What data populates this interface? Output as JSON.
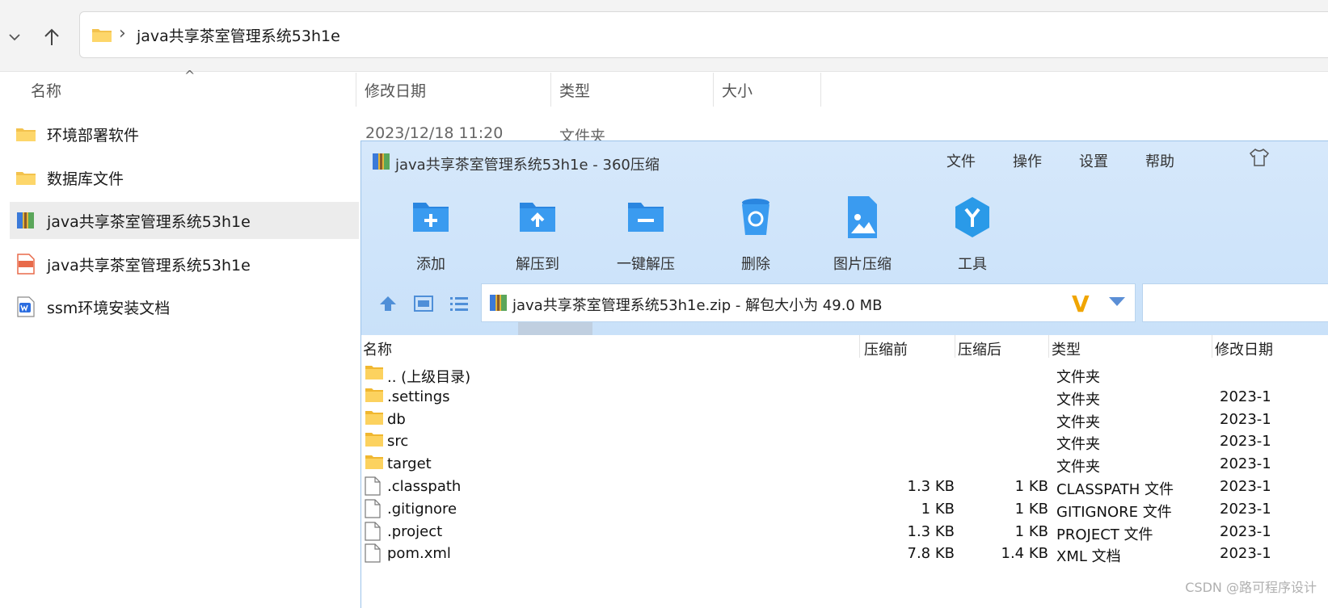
{
  "explorer": {
    "address_path": "java共享茶室管理系统53h1e",
    "columns": {
      "name": "名称",
      "modified": "修改日期",
      "type": "类型",
      "size": "大小"
    },
    "items": [
      {
        "name": "环境部署软件",
        "date": "2023/12/18 11:20",
        "type": "文件夹",
        "icon": "folder-icon"
      },
      {
        "name": "数据库文件",
        "icon": "folder-icon"
      },
      {
        "name": "java共享茶室管理系统53h1e",
        "icon": "zip-archive-icon",
        "selected": true
      },
      {
        "name": "java共享茶室管理系统53h1e",
        "icon": "mp4-video-icon"
      },
      {
        "name": "ssm环境安装文档",
        "icon": "word-doc-icon"
      }
    ]
  },
  "zip": {
    "title": "java共享茶室管理系统53h1e - 360压缩",
    "menu": [
      "文件",
      "操作",
      "设置",
      "帮助"
    ],
    "toolbar": [
      {
        "label": "添加",
        "icon": "add-icon"
      },
      {
        "label": "解压到",
        "icon": "extract-to-icon"
      },
      {
        "label": "一键解压",
        "icon": "one-click-extract-icon"
      },
      {
        "label": "删除",
        "icon": "delete-icon"
      },
      {
        "label": "图片压缩",
        "icon": "image-compress-icon"
      },
      {
        "label": "工具",
        "icon": "tools-icon"
      }
    ],
    "path_text": "java共享茶室管理系统53h1e.zip - 解包大小为 49.0 MB",
    "columns": {
      "name": "名称",
      "before": "压缩前",
      "after": "压缩后",
      "type": "类型",
      "modified": "修改日期"
    },
    "files": [
      {
        "name": ".. (上级目录)",
        "before": "",
        "after": "",
        "type": "文件夹",
        "date": "",
        "icon": "folder-icon"
      },
      {
        "name": ".settings",
        "before": "",
        "after": "",
        "type": "文件夹",
        "date": "2023-1",
        "icon": "folder-icon"
      },
      {
        "name": "db",
        "before": "",
        "after": "",
        "type": "文件夹",
        "date": "2023-1",
        "icon": "folder-icon"
      },
      {
        "name": "src",
        "before": "",
        "after": "",
        "type": "文件夹",
        "date": "2023-1",
        "icon": "folder-icon"
      },
      {
        "name": "target",
        "before": "",
        "after": "",
        "type": "文件夹",
        "date": "2023-1",
        "icon": "folder-icon"
      },
      {
        "name": ".classpath",
        "before": "1.3 KB",
        "after": "1 KB",
        "type": "CLASSPATH 文件",
        "date": "2023-1",
        "icon": "file-icon"
      },
      {
        "name": ".gitignore",
        "before": "1 KB",
        "after": "1 KB",
        "type": "GITIGNORE 文件",
        "date": "2023-1",
        "icon": "file-icon"
      },
      {
        "name": ".project",
        "before": "1.3 KB",
        "after": "1 KB",
        "type": "PROJECT 文件",
        "date": "2023-1",
        "icon": "file-icon"
      },
      {
        "name": "pom.xml",
        "before": "7.8 KB",
        "after": "1.4 KB",
        "type": "XML 文档",
        "date": "2023-1",
        "icon": "file-icon"
      }
    ]
  },
  "watermark": "CSDN @路可程序设计"
}
